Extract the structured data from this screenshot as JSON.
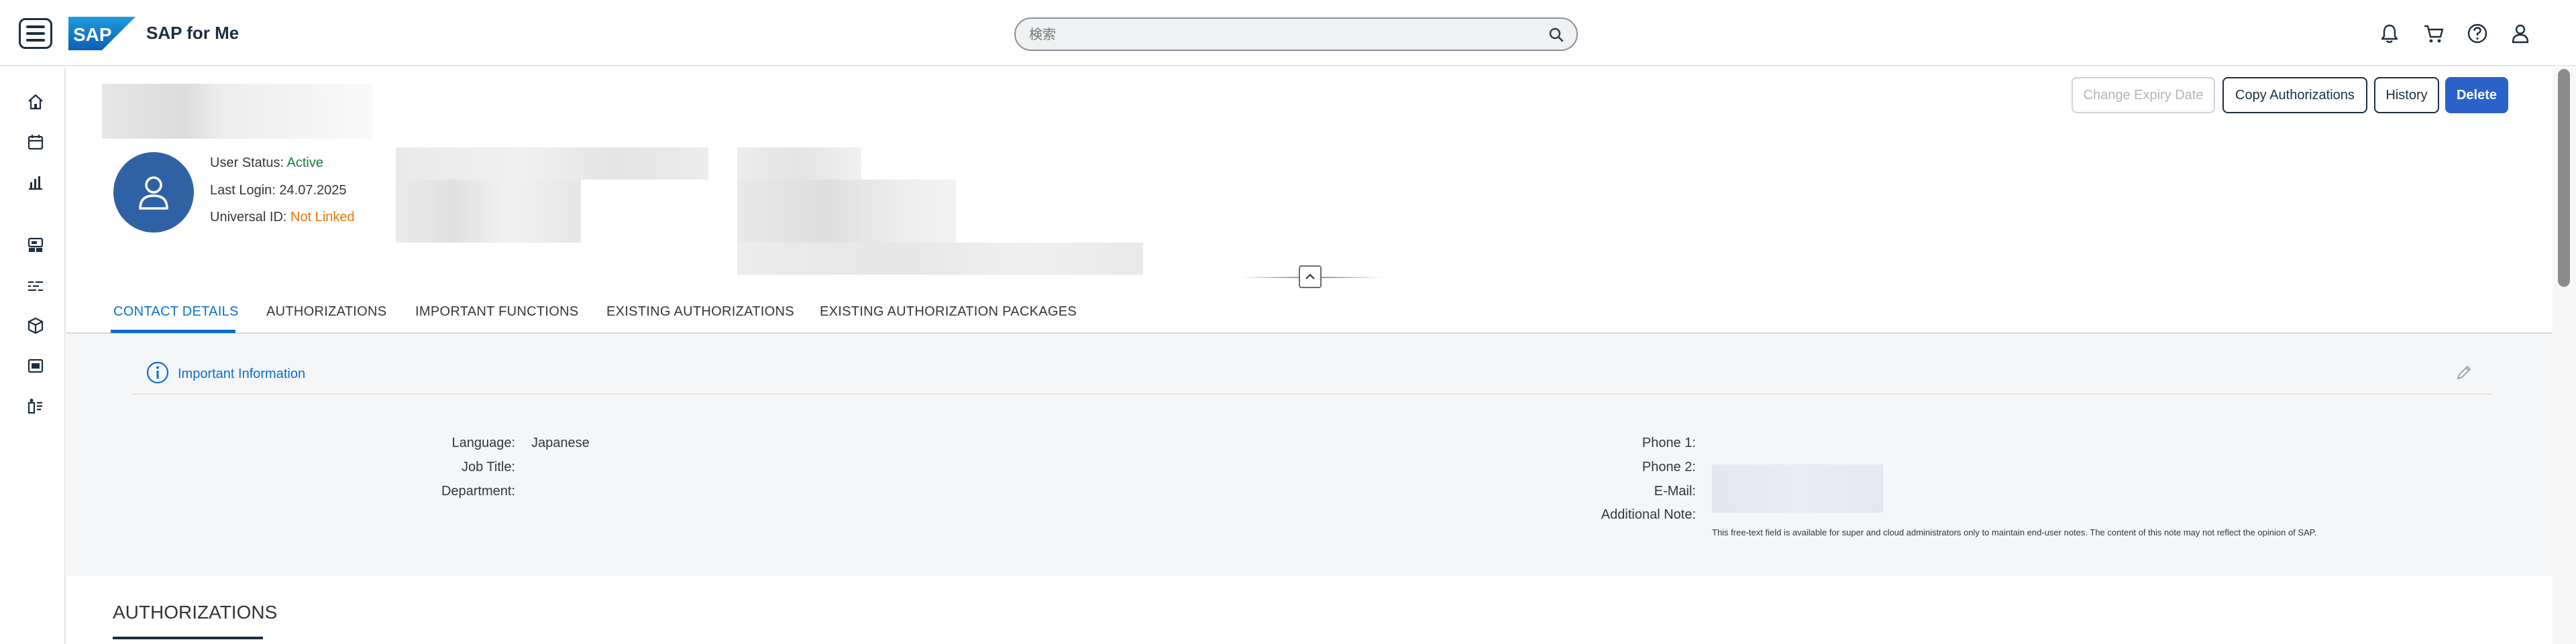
{
  "header": {
    "app_title": "SAP for Me",
    "logo_text": "SAP",
    "search_placeholder": "検索",
    "icons": [
      "menu-icon",
      "search-icon",
      "bell-icon",
      "cart-icon",
      "help-icon",
      "user-icon"
    ]
  },
  "side_nav": {
    "icons": [
      "home-icon",
      "calendar-icon",
      "bar-chart-icon",
      "dashboard-icon",
      "timeline-icon",
      "package-icon",
      "screen-icon",
      "product-icon"
    ]
  },
  "actions": {
    "change_expiry": "Change Expiry Date",
    "copy_auth": "Copy Authorizations",
    "history": "History",
    "delete": "Delete"
  },
  "user": {
    "status_label": "User Status:",
    "status_value": "Active",
    "login_label": "Last Login:",
    "login_value": "24.07.2025",
    "uid_label": "Universal ID:",
    "uid_value": "Not Linked"
  },
  "tabs": [
    {
      "label": "CONTACT DETAILS"
    },
    {
      "label": "AUTHORIZATIONS"
    },
    {
      "label": "IMPORTANT FUNCTIONS"
    },
    {
      "label": "EXISTING AUTHORIZATIONS"
    },
    {
      "label": "EXISTING AUTHORIZATION PACKAGES"
    }
  ],
  "contact": {
    "important_info": "Important Information",
    "language_label": "Language:",
    "language_value": "Japanese",
    "job_title_label": "Job Title:",
    "department_label": "Department:",
    "phone1_label": "Phone 1:",
    "phone2_label": "Phone 2:",
    "email_label": "E-Mail:",
    "additional_note_label": "Additional Note:",
    "note_text": "This free-text field is available for super and cloud administrators only to maintain end-user notes. The content of this note may not reflect the opinion of SAP."
  },
  "section": {
    "title": "AUTHORIZATIONS"
  },
  "colors": {
    "brand_blue": "#0a6ed1",
    "primary_button": "#2a62c9",
    "avatar": "#2f62a5",
    "active": "#107e3e",
    "warning": "#e9730c"
  }
}
